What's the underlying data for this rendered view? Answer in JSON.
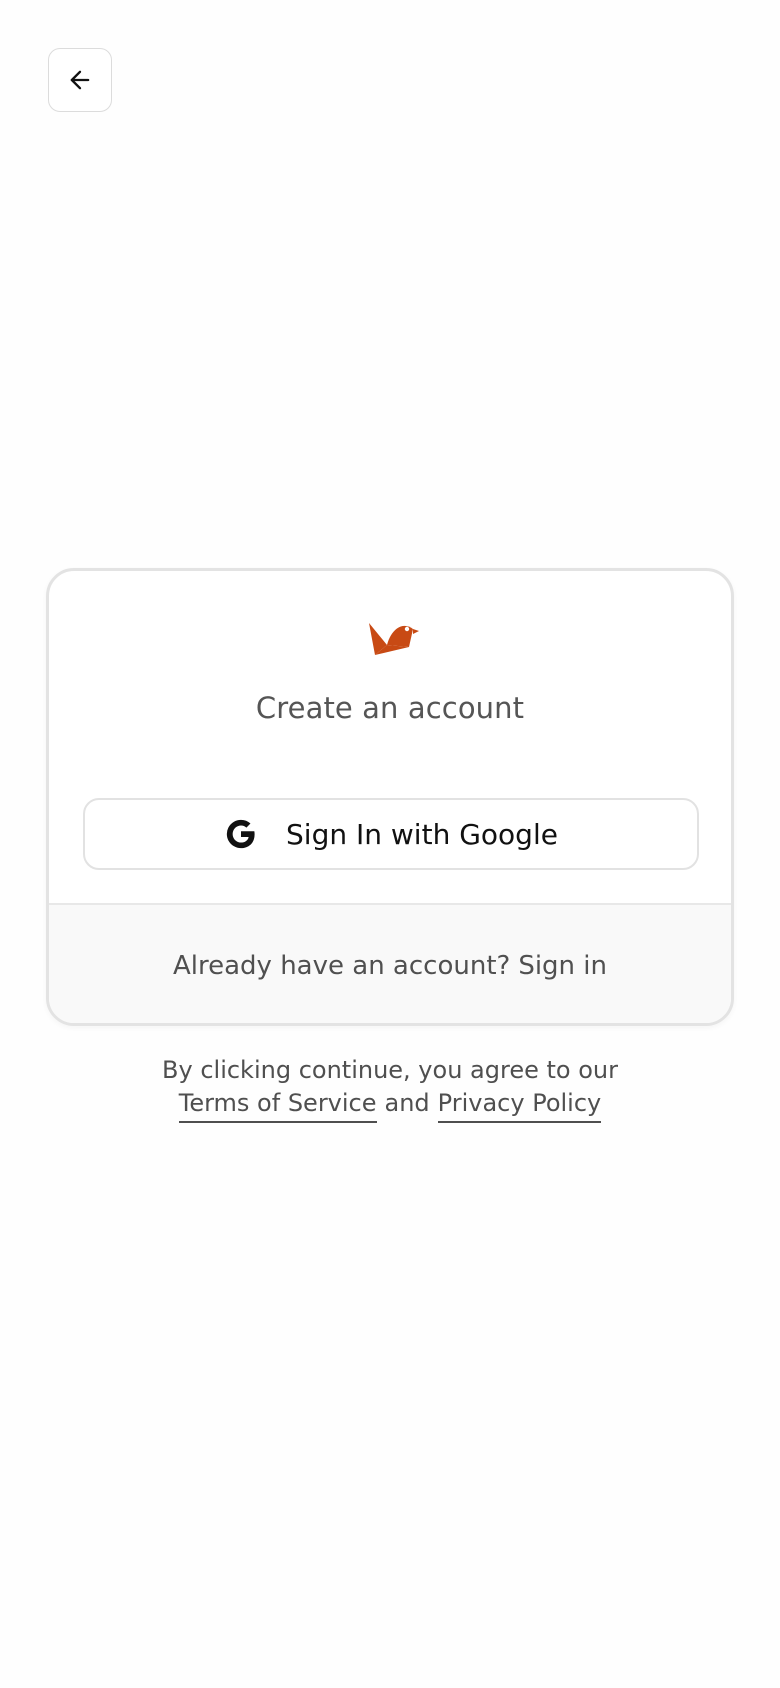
{
  "header": {
    "back_icon": "arrow-left-icon"
  },
  "card": {
    "logo_icon": "bird-logo-icon",
    "logo_color": "#c84a14",
    "title": "Create an account",
    "google_button": {
      "icon": "google-icon",
      "label": "Sign In with Google"
    },
    "footer": {
      "prompt": "Already have an account?",
      "link": "Sign in"
    }
  },
  "legal": {
    "text": "By clicking continue, you agree to our",
    "terms": "Terms of Service",
    "conjunction": "and",
    "privacy": "Privacy Policy"
  }
}
